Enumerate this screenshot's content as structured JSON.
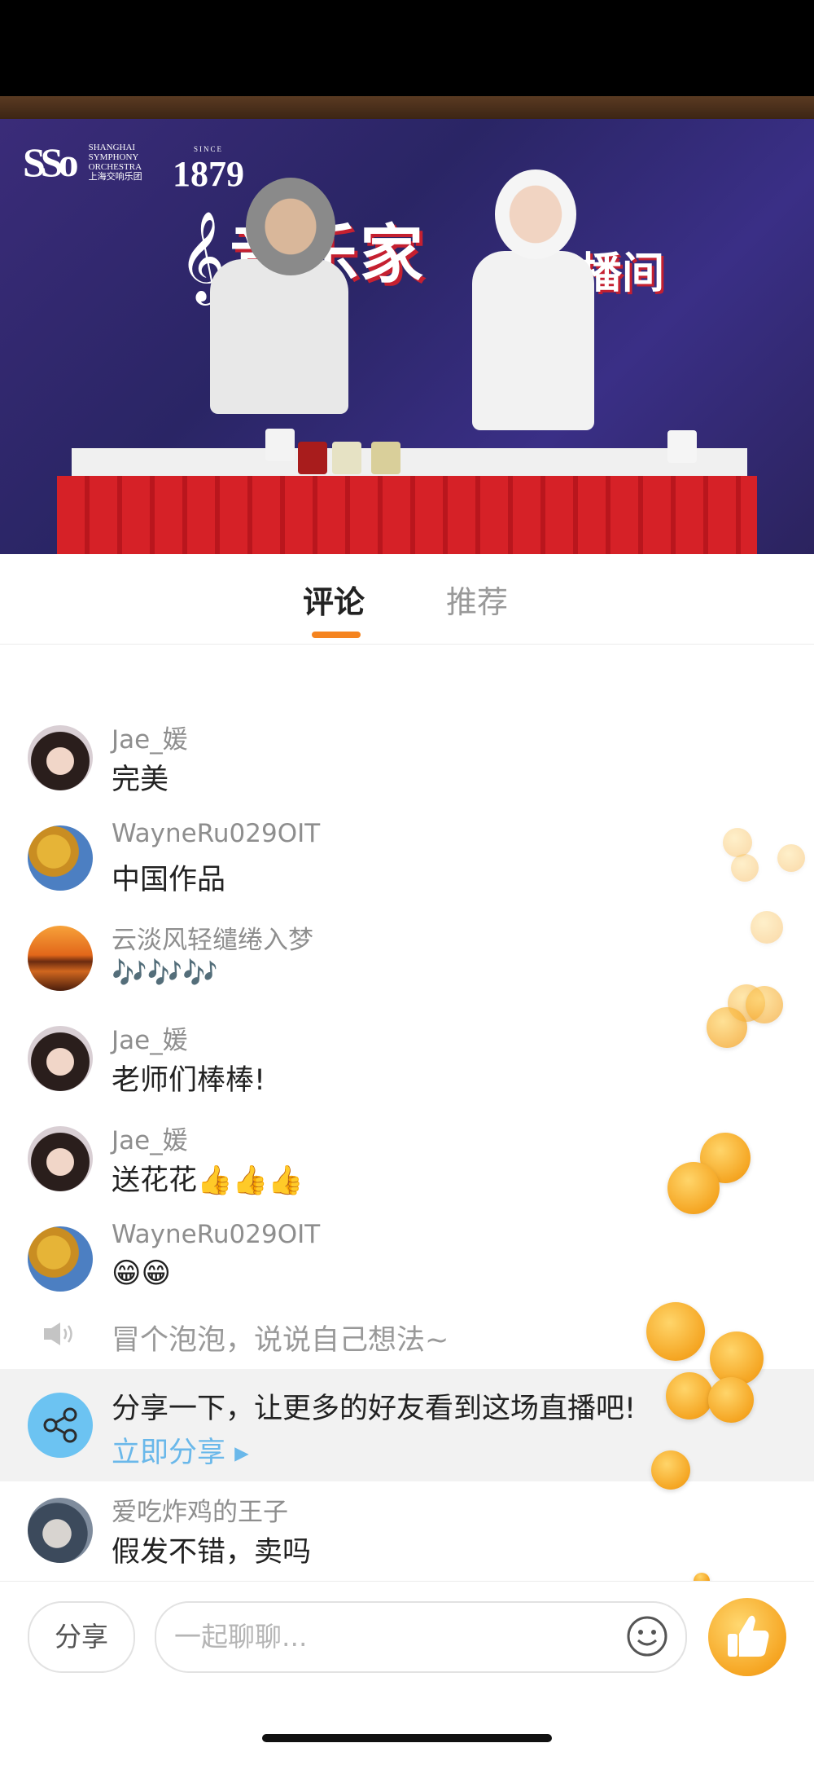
{
  "video": {
    "logo_text": "SSo",
    "org_name_en": "SHANGHAI SYMPHONY ORCHESTRA",
    "org_name_zh": "上海交响乐团",
    "since_label": "SINCE",
    "since_year": "1879",
    "banner_title": "音乐家",
    "banner_subtitle": "直播间"
  },
  "tabs": {
    "comments": "评论",
    "recommend": "推荐"
  },
  "comments": [
    {
      "user": "Jae_媛",
      "text": "完美"
    },
    {
      "user": "WayneRu029OIT",
      "text": "中国作品"
    },
    {
      "user": "云淡风轻缱绻入梦",
      "text": "🎶🎶🎶"
    },
    {
      "user": "Jae_媛",
      "text": "老师们棒棒!"
    },
    {
      "user": "Jae_媛",
      "text": "送花花👍👍👍"
    },
    {
      "user": "WayneRu029OIT",
      "text": "😁😁"
    },
    {
      "user": "爱吃炸鸡的王子",
      "text": "假发不错，卖吗"
    }
  ],
  "bubble_hint": "冒个泡泡，说说自己想法~",
  "share_banner": {
    "text": "分享一下，让更多的好友看到这场直播吧!",
    "link": "立即分享 ▸"
  },
  "bottom_bar": {
    "share_label": "分享",
    "chat_placeholder": "一起聊聊..."
  },
  "icons": [
    "speaker-icon",
    "share-nodes-icon",
    "smiley-icon",
    "thumbs-up-icon"
  ],
  "colors": {
    "accent_orange": "#f5841f",
    "share_link_blue": "#6ab8ea",
    "share_icon_bg": "#6cc3f2",
    "thumb_yellow": "#f6a623"
  }
}
